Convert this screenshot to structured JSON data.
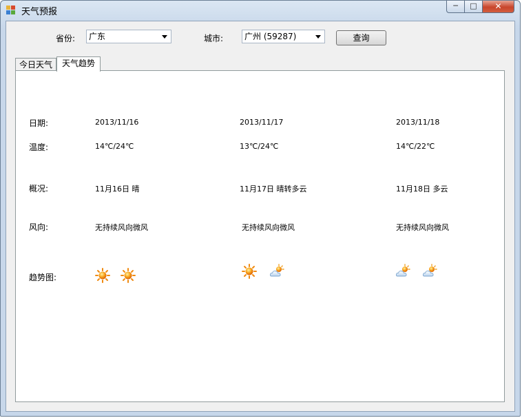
{
  "window": {
    "title": "天气预报",
    "controls": [
      "─",
      "□",
      "✕"
    ]
  },
  "query": {
    "province_label": "省份:",
    "province_value": "广东",
    "city_label": "城市:",
    "city_value": "广州 (59287)",
    "search_button": "查询"
  },
  "tabs": [
    {
      "label": "今日天气",
      "active": false
    },
    {
      "label": "天气趋势",
      "active": true
    }
  ],
  "rows": {
    "date": "日期:",
    "temperature": "温度:",
    "overview": "概况:",
    "wind": "风向:",
    "trend": "趋势图:"
  },
  "forecast": [
    {
      "date": "2013/11/16",
      "temp": "14℃/24℃",
      "summary": "11月16日 晴",
      "wind": "无持续风向微风",
      "icons": [
        "sunny-icon",
        "sunny-icon"
      ]
    },
    {
      "date": "2013/11/17",
      "temp": "13℃/24℃",
      "summary": "11月17日 晴转多云",
      "wind": "无持续风向微风",
      "icons": [
        "sunny-icon",
        "partly-cloudy-icon"
      ]
    },
    {
      "date": "2013/11/18",
      "temp": "14℃/22℃",
      "summary": "11月18日 多云",
      "wind": "无持续风向微风",
      "icons": [
        "partly-cloudy-icon",
        "partly-cloudy-icon"
      ]
    }
  ]
}
